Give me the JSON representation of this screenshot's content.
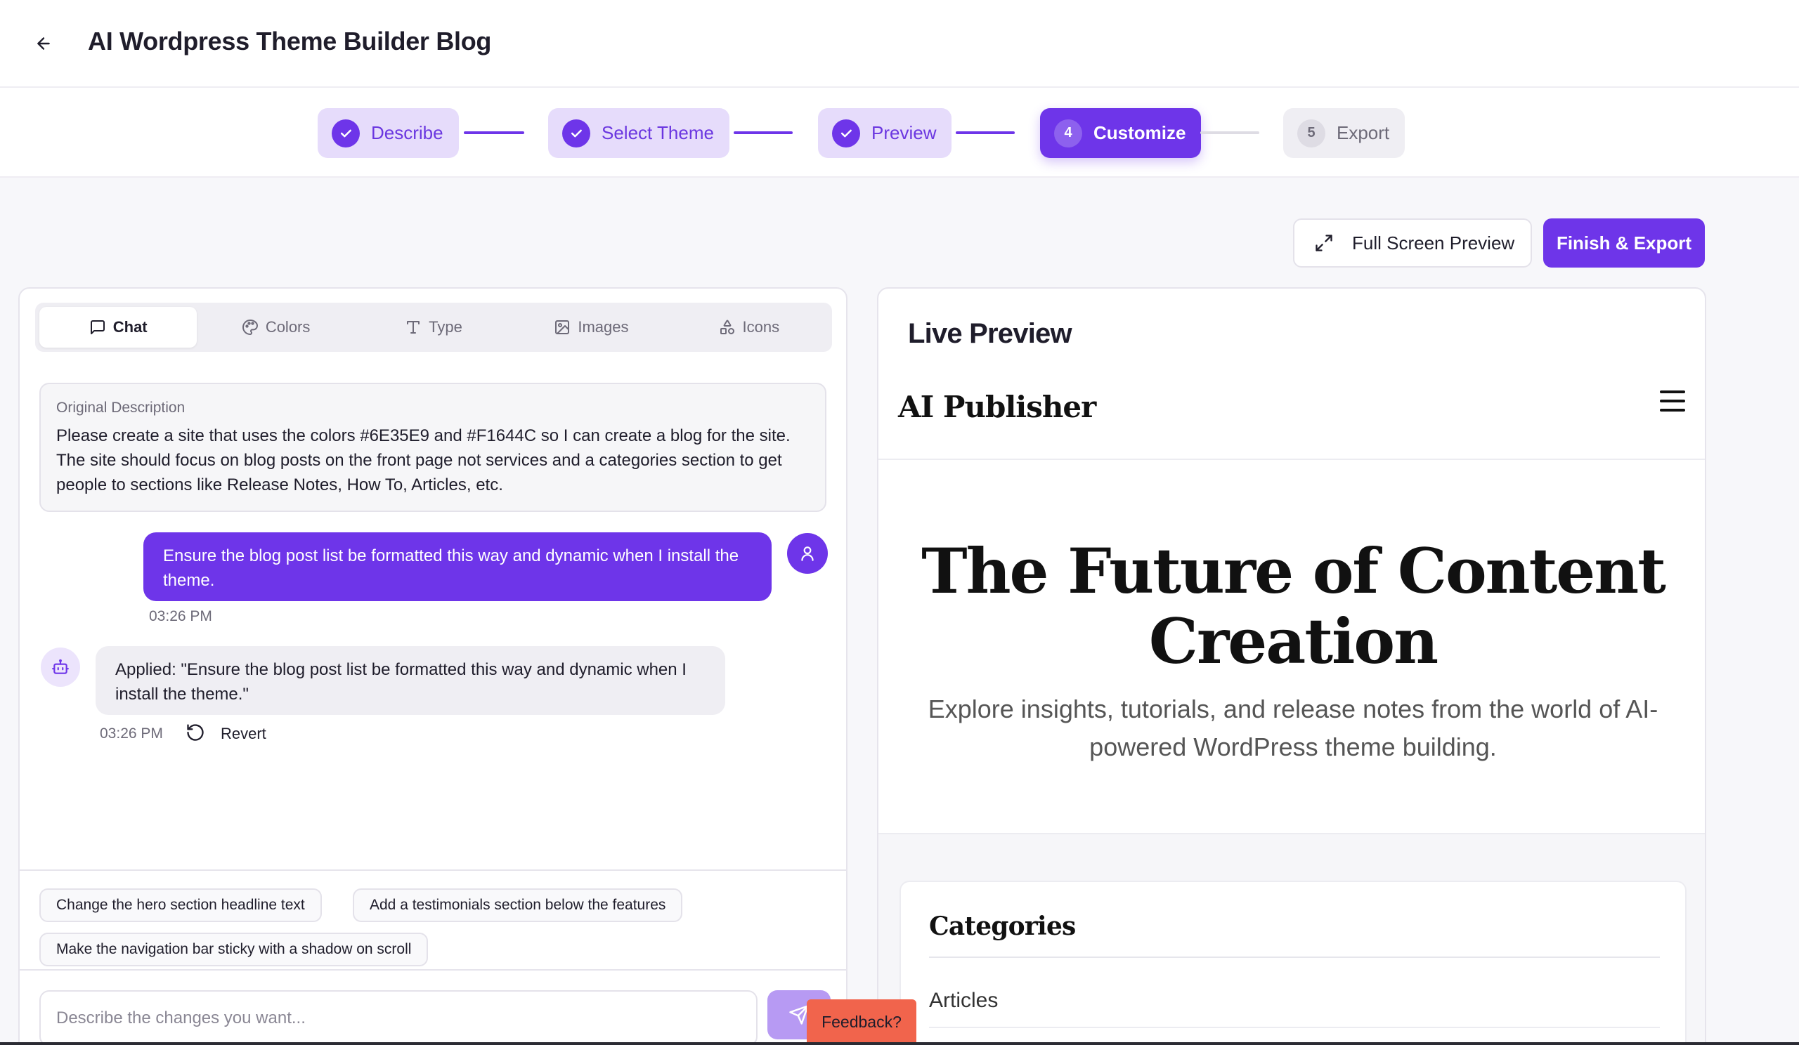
{
  "header": {
    "title": "AI Wordpress Theme Builder Blog",
    "back_icon": "arrow-left-icon"
  },
  "steps": [
    {
      "label": "Describe",
      "state": "done"
    },
    {
      "label": "Select Theme",
      "state": "done"
    },
    {
      "label": "Preview",
      "state": "done"
    },
    {
      "label": "Customize",
      "state": "active",
      "number": "4"
    },
    {
      "label": "Export",
      "state": "todo",
      "number": "5"
    }
  ],
  "toolbar": {
    "fullscreen_label": "Full Screen Preview",
    "export_label": "Finish & Export"
  },
  "editor": {
    "tabs": [
      {
        "label": "Chat",
        "icon": "chat-bubble-icon",
        "active": true
      },
      {
        "label": "Colors",
        "icon": "palette-icon",
        "active": false
      },
      {
        "label": "Type",
        "icon": "type-icon",
        "active": false
      },
      {
        "label": "Images",
        "icon": "image-icon",
        "active": false
      },
      {
        "label": "Icons",
        "icon": "shapes-icon",
        "active": false
      }
    ],
    "original": {
      "label": "Original Description",
      "text": "Please create a site that uses the colors #6E35E9 and #F1644C so I can create a blog for the site. The site should focus on blog posts on the front page not services and a categories section to get people to sections like Release Notes, How To, Articles, etc."
    },
    "messages": {
      "user": {
        "text": "Ensure the blog post list be formatted this way and dynamic when I install the theme.",
        "time": "03:26 PM"
      },
      "bot": {
        "text": "Applied: \"Ensure the blog post list be formatted this way and dynamic when I install the theme.\"",
        "time": "03:26 PM",
        "revert_label": "Revert"
      }
    },
    "suggestions": [
      "Change the hero section headline text",
      "Add a testimonials section below the features",
      "Make the navigation bar sticky with a shadow on scroll"
    ],
    "input": {
      "placeholder": "Describe the changes you want...",
      "value": ""
    }
  },
  "preview": {
    "title": "Live Preview",
    "site": {
      "brand": "AI Publisher",
      "hero_title": "The Future of Content Creation",
      "hero_subtitle": "Explore insights, tutorials, and release notes from the world of AI-powered WordPress theme building.",
      "categories_title": "Categories",
      "categories": [
        "Articles"
      ]
    }
  },
  "feedback_label": "Feedback?",
  "colors": {
    "primary": "#6E35E9",
    "accent": "#F1644C",
    "primary_soft": "#E6DCFB"
  }
}
